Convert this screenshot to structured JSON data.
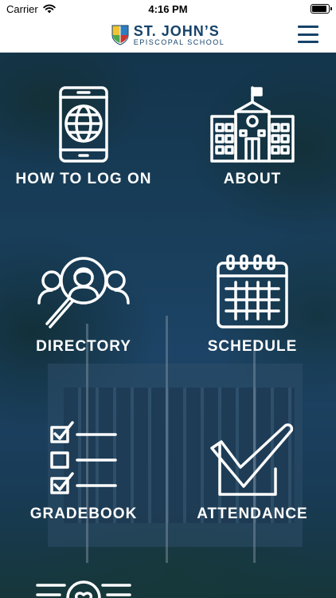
{
  "status_bar": {
    "carrier": "Carrier",
    "time": "4:16 PM",
    "wifi_icon": "wifi-icon",
    "battery_icon": "battery-icon",
    "battery_level": 0.9
  },
  "header": {
    "logo_name": "ST. JOHN’S",
    "logo_subtitle": "EPISCOPAL SCHOOL",
    "menu_icon": "hamburger-menu-icon",
    "brand_color": "#16436a"
  },
  "tiles": [
    {
      "label": "HOW TO LOG ON",
      "icon": "phone-globe-icon"
    },
    {
      "label": "ABOUT",
      "icon": "school-building-icon"
    },
    {
      "label": "DIRECTORY",
      "icon": "people-search-icon"
    },
    {
      "label": "SCHEDULE",
      "icon": "calendar-icon"
    },
    {
      "label": "GRADEBOOK",
      "icon": "checklist-icon"
    },
    {
      "label": "ATTENDANCE",
      "icon": "checkmark-box-icon"
    },
    {
      "label": "",
      "icon": "heart-lines-icon"
    }
  ],
  "colors": {
    "tile_text": "#ffffff",
    "overlay": "#1f4d73"
  }
}
